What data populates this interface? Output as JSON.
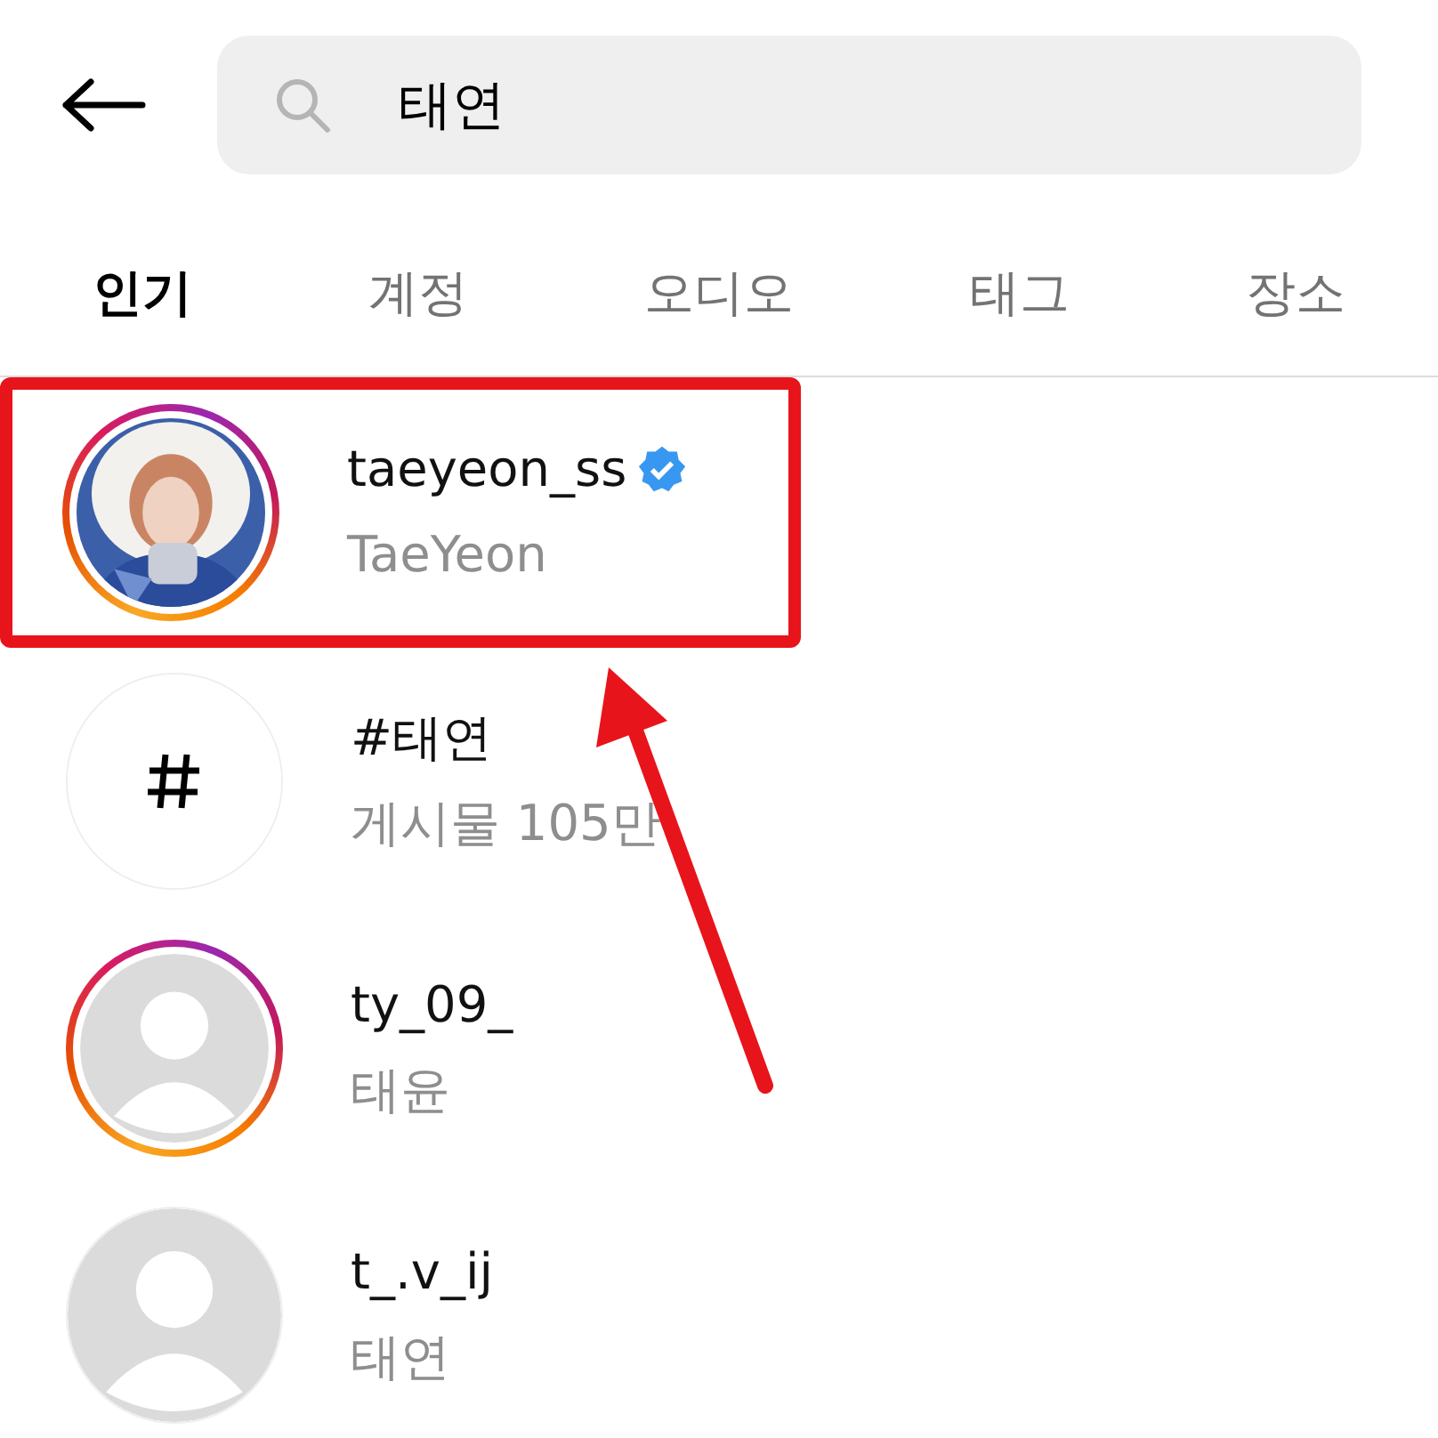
{
  "search": {
    "value": "태연"
  },
  "tabs": [
    {
      "label": "인기",
      "selected": true
    },
    {
      "label": "계정",
      "selected": false
    },
    {
      "label": "오디오",
      "selected": false
    },
    {
      "label": "태그",
      "selected": false
    },
    {
      "label": "장소",
      "selected": false
    }
  ],
  "results": [
    {
      "kind": "account_photo",
      "title": "taeyeon_ss",
      "subtitle": "TaeYeon",
      "verified": true,
      "story_ring": true,
      "highlighted": true
    },
    {
      "kind": "hashtag",
      "title": "#태연",
      "subtitle": "게시물 105만",
      "verified": false,
      "story_ring": false,
      "highlighted": false
    },
    {
      "kind": "account_default",
      "title": "ty_09_",
      "subtitle": "태윤",
      "verified": false,
      "story_ring": true,
      "highlighted": false
    },
    {
      "kind": "account_default",
      "title": "t_.v_ij",
      "subtitle": "태연",
      "verified": false,
      "story_ring": false,
      "highlighted": false
    }
  ],
  "annotation": {
    "arrow": true
  }
}
